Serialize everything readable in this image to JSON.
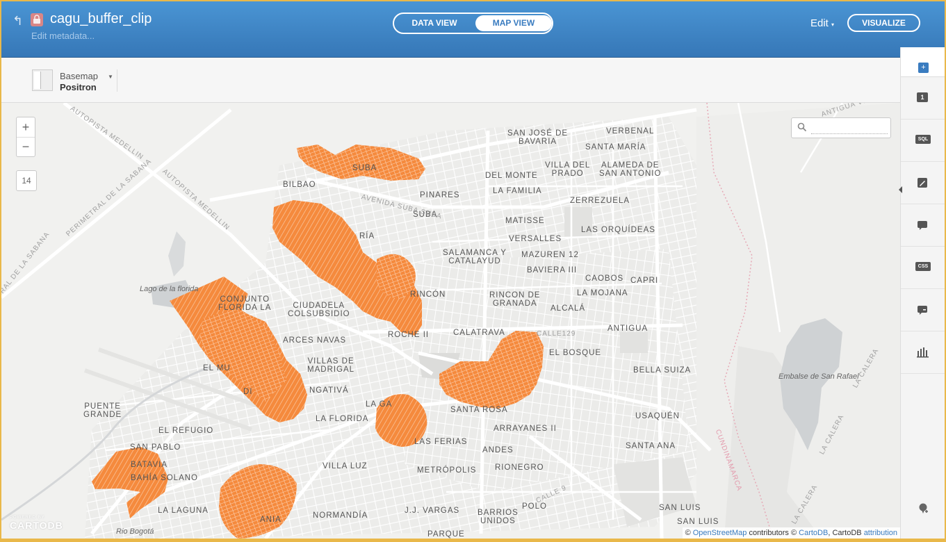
{
  "header": {
    "dataset_name": "cagu_buffer_clip",
    "edit_metadata": "Edit metadata...",
    "view_data": "DATA VIEW",
    "view_map": "MAP VIEW",
    "edit_menu": "Edit",
    "visualize": "VISUALIZE"
  },
  "basemap": {
    "label": "Basemap",
    "value": "Positron"
  },
  "map": {
    "zoom_in": "+",
    "zoom_out": "−",
    "zoom_level": "14",
    "search_placeholder": "",
    "labels": {
      "san_jose_bavaria": "SAN JOSÉ DE\nBAVARIA",
      "verbenal": "VERBENAL",
      "santa_maria": "SANTA MARÍA",
      "villa_del_prado": "VILLA DEL\nPRADO",
      "alameda": "ALAMEDA DE\nSAN ANTONIO",
      "del_monte": "DEL MONTE",
      "la_familia": "LA FAMILIA",
      "pinares": "PINARES",
      "zerrezuela": "ZERREZUELA",
      "bilbao": "BILBAO",
      "suba": "SUBA",
      "matisse": "MATISSE",
      "las_orquideas": "LAS ORQUÍDEAS",
      "versalles": "VERSALLES",
      "mazuren": "MAZUREN 12",
      "salamanca": "SALAMANCA Y\nCATALAYUD",
      "baviera": "BAVIERA III",
      "caobos": "CAOBOS",
      "capri": "CAPRI",
      "la_mojana": "LA MOJANA",
      "rincon": "RINCÓN",
      "rincon_granada": "RINCON DE\nGRANADA",
      "alcala": "ALCALÁ",
      "antigua": "ANTIGUA",
      "conjunto": "CONJUNTO\nFLORIDA LA",
      "ciudadela": "CIUDADELA\nCOLSUBSIDIO",
      "calatrava": "CALATRAVA",
      "el_bosque": "EL BOSQUE",
      "bella_suiza": "BELLA SUIZA",
      "aranjuez": "ARCES NAVAS",
      "villas_madrigal": "VILLAS DE\nMADRIGAL",
      "el_muelle": "EL MU",
      "engativa": "NGATIVÁ",
      "la_florida": "LA FLORIDA",
      "santa_rosa": "SANTA ROSA",
      "usaquen": "USAQUÉN",
      "puente_grande": "PUENTE\nGRANDE",
      "el_refugio": "EL REFUGIO",
      "las_ferias": "LAS FERIAS",
      "arrayanes": "ARRAYANES II",
      "santa_ana": "SANTA ANA",
      "san_pablo": "SAN PABLO",
      "batavia": "BATAVIA",
      "bahia_solano": "BAHÍA SOLANO",
      "villa_luz": "VILLA LUZ",
      "andes": "ANDES",
      "rionegro": "RIONEGRO",
      "metropolis": "METRÓPOLIS",
      "la_laguna": "LA LAGUNA",
      "jj_vargas": "J.J. VARGAS",
      "normandia": "NORMANDÍA",
      "barrios_unidos": "BARRIOS\nUNIDOS",
      "polo": "POLO",
      "san_luis": "SAN LUIS",
      "san_luis2": "SAN LUIS",
      "parque": "PARQUE",
      "la_ga": "LA GA",
      "roche": "ROCHE II",
      "ria": "RÍA",
      "ania": "ANIA",
      "suba_top": "SUBA",
      "di": "DI"
    },
    "water": {
      "lago_florida": "Lago de la florida",
      "embalse": "Embalse de San Rafael",
      "rio_bogota": "Rio Bogotá"
    },
    "roads": {
      "autopista_medellin_1": "AUTOPISTA MEDELLIN",
      "autopista_medellin_2": "AUTOPISTA MEDELLIN",
      "perimetral": "PERIMETRAL DE LA SABANA",
      "perimetral2": "RAL DE LA SABANA",
      "avenida_suba": "AVENIDA SUBA SUBA",
      "antigua_via": "ANTIGUA VIA",
      "cundinamarca": "CUNDINAMARCA",
      "la_calera": "LA CALERA",
      "la_calera2": "LA CALERA",
      "la_calera3": "LA CALERA",
      "calle129": "CALLE129",
      "calle90": "CALLE 9"
    },
    "attribution": {
      "copy1": "© ",
      "osm": "OpenStreetMap",
      "contrib": " contributors © ",
      "cartodb": "CartoDB",
      "cartodb2": ", CartoDB ",
      "attr": "attribution"
    },
    "logo": {
      "powered": "POWERED BY",
      "name": "CARTODB"
    }
  },
  "rightpanel": {
    "add_layer": "+",
    "layer_number": "1",
    "sql": "SQL",
    "css": "CSS"
  },
  "colors": {
    "header": "#3f86c8",
    "polygon": "#f58a3d",
    "accent": "#3a7cc0"
  }
}
